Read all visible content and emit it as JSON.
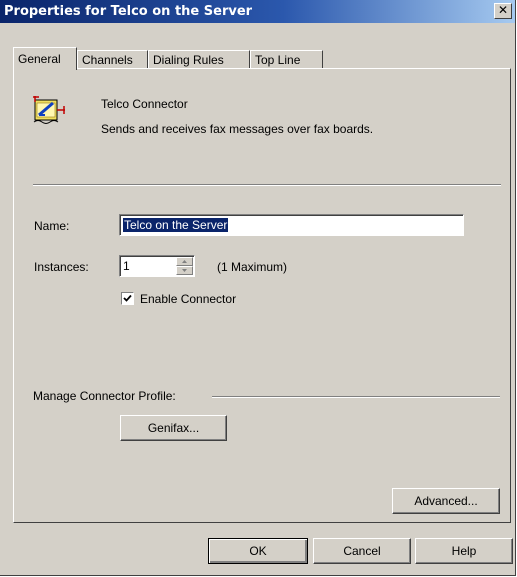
{
  "window": {
    "title": "Properties for Telco on the Server",
    "close_glyph": "✕"
  },
  "tabs": [
    {
      "label": "General",
      "active": true
    },
    {
      "label": "Channels",
      "active": false
    },
    {
      "label": "Dialing Rules",
      "active": false
    },
    {
      "label": "Top Line",
      "active": false
    }
  ],
  "connector": {
    "icon": "telco-connector-icon",
    "name": "Telco Connector",
    "description": "Sends and receives fax messages over fax boards."
  },
  "form": {
    "name_label": "Name:",
    "name_value": "Telco on the Server",
    "instances_label": "Instances:",
    "instances_value": "1",
    "instances_note": "(1 Maximum)",
    "enable_label": "Enable Connector",
    "enable_checked": true
  },
  "profile": {
    "group_label": "Manage Connector Profile:",
    "genifax_button": "Genifax..."
  },
  "buttons": {
    "advanced": "Advanced...",
    "ok": "OK",
    "cancel": "Cancel",
    "help": "Help"
  },
  "colors": {
    "titlebar_start": "#0a246a",
    "titlebar_end": "#a6caf0",
    "face": "#d4d0c8",
    "selection": "#0a246a"
  }
}
